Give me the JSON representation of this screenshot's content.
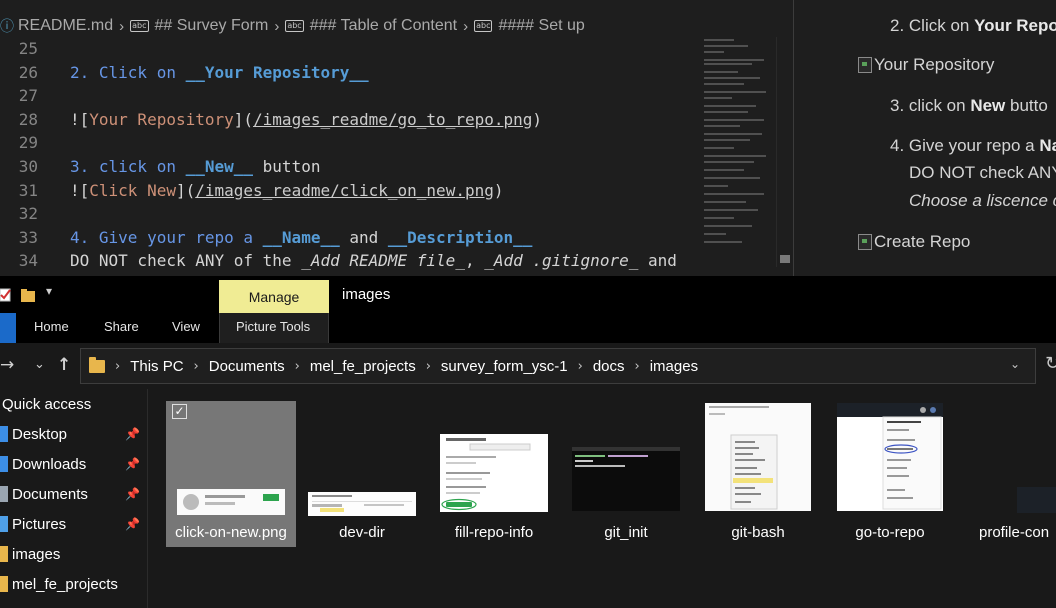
{
  "editor": {
    "breadcrumb": [
      {
        "icon": "markdown-file-icon",
        "label": "README.md"
      },
      {
        "icon": "symbol-string-icon",
        "label": "## Survey Form"
      },
      {
        "icon": "symbol-string-icon",
        "label": "### Table of Content"
      },
      {
        "icon": "symbol-string-icon",
        "label": "#### Set up"
      }
    ],
    "lines": [
      {
        "num": "25"
      },
      {
        "num": "26",
        "a": "2. Click on ",
        "b": "__Your Repository__"
      },
      {
        "num": "27"
      },
      {
        "num": "28",
        "a": "![",
        "b": "Your Repository",
        "c": "](",
        "d": "/images_readme/go_to_repo.png",
        "e": ")"
      },
      {
        "num": "29"
      },
      {
        "num": "30",
        "a": "3. click on ",
        "b": "__New__",
        "c": " button"
      },
      {
        "num": "31",
        "a": "![",
        "b": "Click New",
        "c": "](",
        "d": "/images_readme/click_on_new.png",
        "e": ")"
      },
      {
        "num": "32"
      },
      {
        "num": "33",
        "a": "4. Give your repo a ",
        "b": "__Name__",
        "c": " and ",
        "d": "__Description__"
      },
      {
        "num": "34",
        "a": "DO NOT check ANY of the ",
        "b": "_Add README file_",
        "c": ", ",
        "d": "_Add .gitignore_",
        "e": " and"
      }
    ]
  },
  "preview": {
    "step2_prefix": "2. Click on ",
    "step2_bold": "Your Repo",
    "img_your_repo_alt": "Your Repository",
    "step3_prefix": "3. click on ",
    "step3_bold": "New",
    "step3_suffix": " butto",
    "step4_prefix": "4. Give your repo a ",
    "step4_bold": "Na",
    "step4_line2": "DO NOT check ANY",
    "step4_line3": "Choose a liscence cl",
    "img_create_repo_alt": "Create Repo"
  },
  "explorer": {
    "manage_tab": "Manage",
    "window_title": "images",
    "tabs": {
      "home": "Home",
      "share": "Share",
      "view": "View",
      "picture_tools": "Picture Tools"
    },
    "path": [
      "This PC",
      "Documents",
      "mel_fe_projects",
      "survey_form_ysc-1",
      "docs",
      "images"
    ],
    "nav": [
      {
        "label": "Quick access",
        "pinned": false
      },
      {
        "label": "Desktop",
        "pinned": true,
        "color": "#3c8ee6"
      },
      {
        "label": "Downloads",
        "pinned": true,
        "color": "#3c8ee6"
      },
      {
        "label": "Documents",
        "pinned": true,
        "color": "#9aa5b1"
      },
      {
        "label": "Pictures",
        "pinned": true,
        "color": "#4fa0e8"
      },
      {
        "label": "images",
        "pinned": false,
        "color": "#e8b64c"
      },
      {
        "label": "mel_fe_projects",
        "pinned": false,
        "color": "#e8b64c"
      }
    ],
    "files": [
      {
        "name": "click-on-new.png",
        "selected": true
      },
      {
        "name": "dev-dir",
        "selected": false
      },
      {
        "name": "fill-repo-info",
        "selected": false
      },
      {
        "name": "git_init",
        "selected": false
      },
      {
        "name": "git-bash",
        "selected": false
      },
      {
        "name": "go-to-repo",
        "selected": false
      },
      {
        "name": "profile-con",
        "selected": false
      }
    ]
  },
  "colors": {
    "accent_manage": "#f0ec94",
    "file_tab": "#1b6ac9",
    "editor_bg": "#1e1e1e",
    "md_bold": "#569cd6",
    "md_link": "#ce9178"
  }
}
